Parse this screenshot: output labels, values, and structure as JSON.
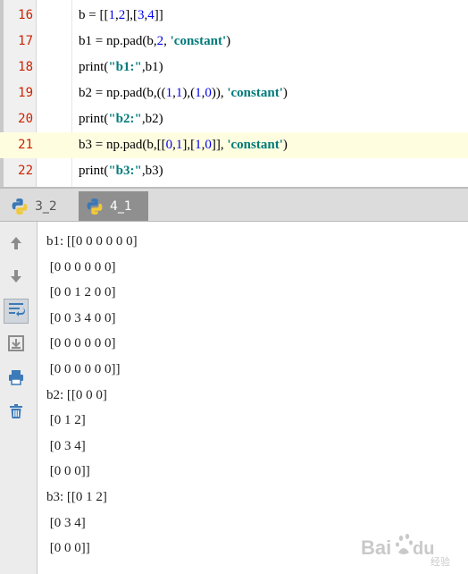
{
  "editor": {
    "lines": [
      {
        "num": "16",
        "current": false,
        "parts": [
          {
            "t": "b = [["
          },
          {
            "t": "1",
            "c": "num"
          },
          {
            "t": ","
          },
          {
            "t": "2",
            "c": "num"
          },
          {
            "t": "],["
          },
          {
            "t": "3",
            "c": "num"
          },
          {
            "t": ","
          },
          {
            "t": "4",
            "c": "num"
          },
          {
            "t": "]]"
          }
        ]
      },
      {
        "num": "17",
        "current": false,
        "parts": [
          {
            "t": "b1 = np.pad(b,"
          },
          {
            "t": "2",
            "c": "num"
          },
          {
            "t": ", "
          },
          {
            "t": "'constant'",
            "c": "str"
          },
          {
            "t": ")"
          }
        ]
      },
      {
        "num": "18",
        "current": false,
        "parts": [
          {
            "t": "print("
          },
          {
            "t": "\"b1:\"",
            "c": "str"
          },
          {
            "t": ",b1)"
          }
        ]
      },
      {
        "num": "19",
        "current": false,
        "parts": [
          {
            "t": "b2 = np.pad(b,(("
          },
          {
            "t": "1",
            "c": "num"
          },
          {
            "t": ","
          },
          {
            "t": "1",
            "c": "num"
          },
          {
            "t": "),("
          },
          {
            "t": "1",
            "c": "num"
          },
          {
            "t": ","
          },
          {
            "t": "0",
            "c": "num"
          },
          {
            "t": ")), "
          },
          {
            "t": "'constant'",
            "c": "str"
          },
          {
            "t": ")"
          }
        ]
      },
      {
        "num": "20",
        "current": false,
        "parts": [
          {
            "t": "print("
          },
          {
            "t": "\"b2:\"",
            "c": "str"
          },
          {
            "t": ",b2)"
          }
        ]
      },
      {
        "num": "21",
        "current": true,
        "parts": [
          {
            "t": "b3 = np.pad(b,[["
          },
          {
            "t": "0",
            "c": "num"
          },
          {
            "t": ","
          },
          {
            "t": "1",
            "c": "num"
          },
          {
            "t": "],["
          },
          {
            "t": "1",
            "c": "num"
          },
          {
            "t": ","
          },
          {
            "t": "0",
            "c": "num"
          },
          {
            "t": "]], "
          },
          {
            "t": "'constant'",
            "c": "str"
          },
          {
            "t": ")"
          }
        ]
      },
      {
        "num": "22",
        "current": false,
        "parts": [
          {
            "t": "print("
          },
          {
            "t": "\"b3:\"",
            "c": "str"
          },
          {
            "t": ",b3)"
          }
        ]
      }
    ]
  },
  "run_tabs": [
    {
      "label": "3_2",
      "active": false
    },
    {
      "label": "4_1",
      "active": true
    }
  ],
  "toolbar": {
    "buttons": [
      {
        "icon": "up-arrow-icon",
        "pressed": false
      },
      {
        "icon": "down-arrow-icon",
        "pressed": false
      },
      {
        "icon": "soft-wrap-icon",
        "pressed": true
      },
      {
        "icon": "scroll-to-end-icon",
        "pressed": false
      },
      {
        "icon": "print-icon",
        "pressed": false
      },
      {
        "icon": "trash-icon",
        "pressed": false
      }
    ]
  },
  "console": {
    "lines": [
      "b1: [[0 0 0 0 0 0]",
      " [0 0 0 0 0 0]",
      " [0 0 1 2 0 0]",
      " [0 0 3 4 0 0]",
      " [0 0 0 0 0 0]",
      " [0 0 0 0 0 0]]",
      "b2: [[0 0 0]",
      " [0 1 2]",
      " [0 3 4]",
      " [0 0 0]]",
      "b3: [[0 1 2]",
      " [0 3 4]",
      " [0 0 0]]"
    ]
  },
  "watermark": {
    "text": "Baidu经验"
  },
  "colors": {
    "line_number": "#cc2200",
    "number": "#0000ee",
    "string": "#007a7a",
    "current_line": "#fffde0",
    "active_tab": "#8f8f8f"
  }
}
